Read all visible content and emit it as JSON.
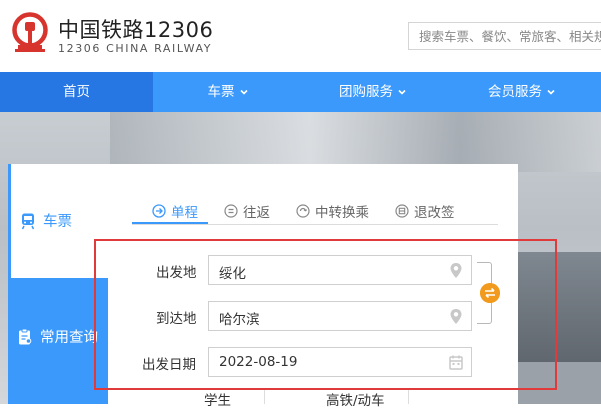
{
  "brand": {
    "name_cn": "中国铁路12306",
    "name_en": "12306 CHINA RAILWAY"
  },
  "search": {
    "placeholder": "搜索车票、餐饮、常旅客、相关规章"
  },
  "nav": {
    "items": [
      {
        "label": "首页",
        "active": true,
        "has_dropdown": false
      },
      {
        "label": "车票",
        "active": false,
        "has_dropdown": true
      },
      {
        "label": "团购服务",
        "active": false,
        "has_dropdown": true
      },
      {
        "label": "会员服务",
        "active": false,
        "has_dropdown": true
      }
    ]
  },
  "sidebar": {
    "items": [
      {
        "label": "车票",
        "icon": "train-icon",
        "active": true
      },
      {
        "label": "常用查询",
        "icon": "clipboard-icon",
        "active": false
      }
    ]
  },
  "tabs": [
    {
      "label": "单程",
      "icon": "arrow-right-circle-icon",
      "active": true
    },
    {
      "label": "往返",
      "icon": "list-circle-icon",
      "active": false
    },
    {
      "label": "中转换乘",
      "icon": "transfer-circle-icon",
      "active": false
    },
    {
      "label": "退改签",
      "icon": "refund-circle-icon",
      "active": false
    }
  ],
  "form": {
    "from": {
      "label": "出发地",
      "value": "绥化"
    },
    "to": {
      "label": "到达地",
      "value": "哈尔滨"
    },
    "date": {
      "label": "出发日期",
      "value": "2022-08-19"
    }
  },
  "options": {
    "student": "学生",
    "high_speed": "高铁/动车"
  },
  "colors": {
    "primary": "#3b99fc",
    "nav_active": "#2676e3",
    "logo_red": "#d6342c",
    "swap_orange": "#f29a1d",
    "highlight": "#e03a3a"
  }
}
